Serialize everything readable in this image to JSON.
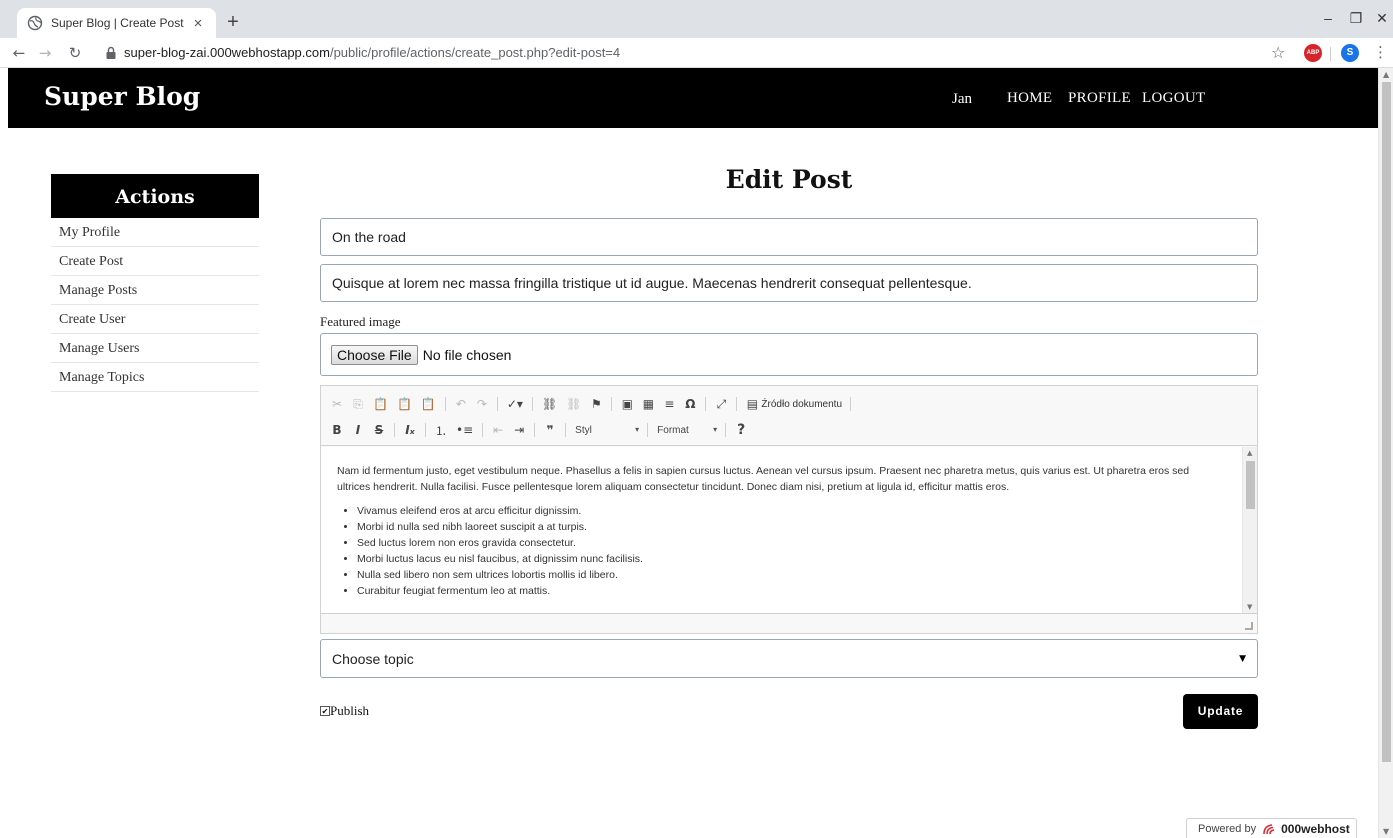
{
  "browser": {
    "tab_title": "Super Blog | Create Post",
    "tab_close": "×",
    "new_tab": "+",
    "url_host": "super-blog-zai.000webhostapp.com",
    "url_path": "/public/profile/actions/create_post.php?edit-post=4",
    "abp_label": "ABP",
    "profile_initial": "S",
    "colors": {
      "tab_strip": "#dee1e6",
      "abp": "#d7242b",
      "profile": "#1a73e8"
    }
  },
  "header": {
    "brand": "Super Blog",
    "user": "Jan",
    "nav": [
      "HOME",
      "PROFILE",
      "LOGOUT"
    ]
  },
  "sidebar": {
    "title": "Actions",
    "items": [
      "My Profile",
      "Create Post",
      "Manage Posts",
      "Create User",
      "Manage Users",
      "Manage Topics"
    ]
  },
  "form": {
    "heading": "Edit Post",
    "title_value": "On the road",
    "excerpt_value": "Quisque at lorem nec massa fringilla tristique ut id augue. Maecenas hendrerit consequat pellentesque.",
    "featured_label": "Featured image",
    "choose_file": "Choose File",
    "no_file": "No file chosen",
    "topic_value": "Choose topic",
    "publish_label": "Publish",
    "publish_checked": true,
    "update_label": "Update"
  },
  "editor": {
    "source_label": "Źródło dokumentu",
    "style_label": "Styl",
    "format_label": "Format",
    "help_label": "?",
    "paragraph": "Nam id fermentum justo, eget vestibulum neque. Phasellus a felis in sapien cursus luctus. Aenean vel cursus ipsum. Praesent nec pharetra metus, quis varius est. Ut pharetra eros sed ultrices hendrerit. Nulla facilisi. Fusce pellentesque lorem aliquam consectetur tincidunt. Donec diam nisi, pretium at ligula id, efficitur mattis eros.",
    "list": [
      "Vivamus eleifend eros at arcu efficitur dignissim.",
      "Morbi id nulla sed nibh laoreet suscipit a at turpis.",
      "Sed luctus lorem non eros gravida consectetur.",
      "Morbi luctus lacus eu nisl faucibus, at dignissim nunc facilisis.",
      "Nulla sed libero non sem ultrices lobortis mollis id libero.",
      "Curabitur feugiat fermentum leo at mattis."
    ],
    "icons": {
      "row1": [
        "cut-icon",
        "copy-icon",
        "paste-icon",
        "paste-text-icon",
        "paste-word-icon",
        "undo-icon",
        "redo-icon",
        "spellcheck-icon",
        "link-icon",
        "unlink-icon",
        "anchor-icon",
        "image-icon",
        "table-icon",
        "horizontal-line-icon",
        "special-char-icon",
        "maximize-icon",
        "source-icon"
      ],
      "row2": [
        "bold-icon",
        "italic-icon",
        "strike-icon",
        "remove-format-icon",
        "numbered-list-icon",
        "bulleted-list-icon",
        "outdent-icon",
        "indent-icon",
        "blockquote-icon"
      ]
    }
  },
  "footer": {
    "powered_by": "Powered by",
    "brand": "000webhost"
  }
}
